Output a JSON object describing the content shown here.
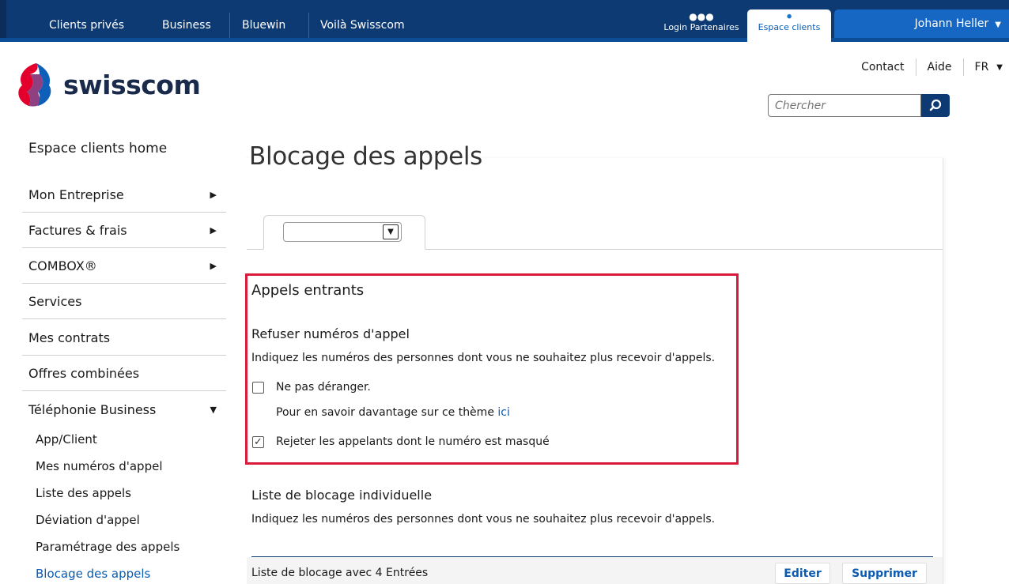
{
  "topnav": {
    "items": [
      "Clients privés",
      "Business",
      "Bluewin",
      "Voilà Swisscom"
    ],
    "login_partenaires": "Login Partenaires",
    "espace_clients": "Espace clients",
    "user_name": "Johann Heller"
  },
  "header": {
    "logo_text": "swisscom",
    "links": {
      "contact": "Contact",
      "aide": "Aide",
      "lang": "FR"
    },
    "search_placeholder": "Chercher"
  },
  "sidebar": {
    "home": "Espace clients home",
    "items": [
      {
        "label": "Mon Entreprise",
        "arrow": "right"
      },
      {
        "label": "Factures & frais",
        "arrow": "right"
      },
      {
        "label": "COMBOX®",
        "arrow": "right"
      },
      {
        "label": "Services"
      },
      {
        "label": "Mes contrats"
      },
      {
        "label": "Offres combinées"
      },
      {
        "label": "Téléphonie Business",
        "arrow": "down"
      }
    ],
    "sub_items": [
      "App/Client",
      "Mes numéros d'appel",
      "Liste des appels",
      "Déviation d'appel",
      "Paramétrage des appels",
      "Blocage des appels"
    ],
    "active_sub": "Blocage des appels"
  },
  "main": {
    "title": "Blocage des appels",
    "incoming": {
      "heading": "Appels entrants",
      "subheading": "Refuser numéros d'appel",
      "description": "Indiquez les numéros des personnes dont vous ne souhaitez plus recevoir d'appels.",
      "dnd_label": "Ne pas déranger.",
      "dnd_checked": false,
      "more_info_text": "Pour en savoir davantage sur ce thème",
      "more_info_link": "ici",
      "reject_hidden_label": "Rejeter les appelants dont le numéro est masqué",
      "reject_hidden_checked": true
    },
    "individual": {
      "heading": "Liste de blocage individuelle",
      "description": "Indiquez les numéros des personnes dont vous ne souhaitez plus recevoir d'appels."
    },
    "list": {
      "summary": "Liste de blocage avec 4 Entrées",
      "edit_label": "Editer",
      "delete_label": "Supprimer"
    }
  },
  "colors": {
    "navy": "#0e3a74",
    "accent_blue": "#1567c3",
    "link_blue": "#0b5cb0",
    "highlight_red": "#d91a3a"
  }
}
